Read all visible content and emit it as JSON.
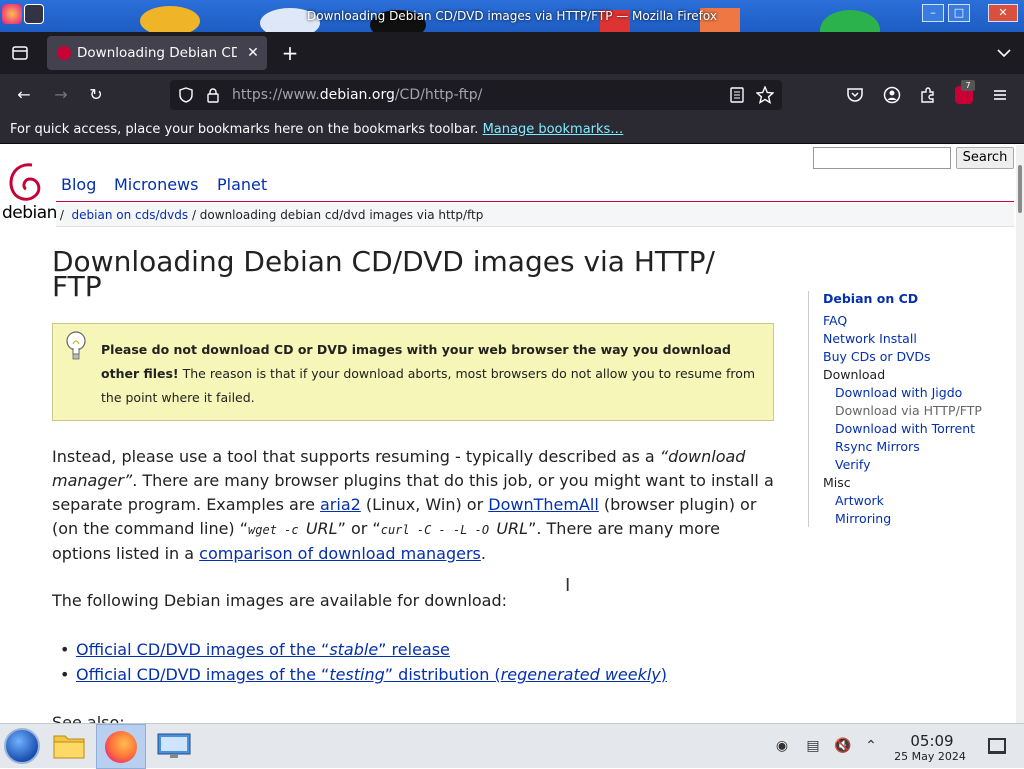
{
  "window": {
    "title": "Downloading Debian CD/DVD images via HTTP/FTP — Mozilla Firefox",
    "minimize_label": "–",
    "maximize_label": "□",
    "close_label": "✕"
  },
  "tabs": [
    {
      "title": "Downloading Debian CD/DVD images via HTTP/FTP",
      "active": true,
      "close_label": "✕"
    }
  ],
  "new_tab_label": "+",
  "tab_list_label": "⌄",
  "nav": {
    "back_label": "←",
    "forward_label": "→",
    "reload_label": "↻",
    "url_prefix": "https://www.",
    "url_host": "debian.org",
    "url_path": "/CD/http-ftp/",
    "extension_badge": "7"
  },
  "bookmarks_bar": {
    "text": "For quick access, place your bookmarks here on the bookmarks toolbar.",
    "link": "Manage bookmarks…"
  },
  "site": {
    "logo_text": "debian",
    "topnav": [
      "Blog",
      "Micronews",
      "Planet"
    ],
    "search_placeholder": "",
    "search_button": "Search",
    "breadcrumb": {
      "sep": "/",
      "link": "debian on cds/dvds",
      "current": "/ downloading debian cd/dvd images via http/ftp"
    },
    "heading_line1": "Downloading Debian CD/DVD images via HTTP/",
    "heading_line2": "FTP",
    "warning": {
      "bold": "Please do not download CD or DVD images with your web browser the way you download other files!",
      "rest": " The reason is that if your download aborts, most browsers do not allow you to resume from the point where it failed."
    },
    "para1": {
      "t1": "Instead, please use a tool that supports resuming - typically described as a ",
      "em1": "“download manager”",
      "t2": ". There are many browser plugins that do this job, or you might want to install a separate program. Examples are ",
      "link1": "aria2",
      "t3": " (Linux, Win) or ",
      "link2": "DownThemAll",
      "t4": " (browser plugin) or (on the command line) “",
      "code1": "wget -c ",
      "em2": "URL",
      "t5": "” or “",
      "code2": "curl -C - -L -O ",
      "em3": "URL",
      "t6": "”. There are many more options listed in a ",
      "link3": "comparison of download managers",
      "t7": "."
    },
    "para2": "The following Debian images are available for download:",
    "list": [
      {
        "pre": "Official CD/DVD images of the “",
        "em": "stable",
        "post": "” release",
        "extra_em": "",
        "extra_post": ""
      },
      {
        "pre": "Official CD/DVD images of the “",
        "em": "testing",
        "post": "” distribution (",
        "extra_em": "regenerated weekly",
        "extra_post": ")"
      }
    ],
    "see_also": "See also:",
    "sidebar": {
      "title": "Debian on CD",
      "items": [
        {
          "label": "FAQ",
          "type": "link"
        },
        {
          "label": "Network Install",
          "type": "link"
        },
        {
          "label": "Buy CDs or DVDs",
          "type": "link"
        },
        {
          "label": "Download",
          "type": "static"
        },
        {
          "label": "Download with Jigdo",
          "type": "link-sub"
        },
        {
          "label": "Download via HTTP/FTP",
          "type": "current-sub"
        },
        {
          "label": "Download with Torrent",
          "type": "link-sub"
        },
        {
          "label": "Rsync Mirrors",
          "type": "link-sub"
        },
        {
          "label": "Verify",
          "type": "link-sub"
        },
        {
          "label": "Misc",
          "type": "static"
        },
        {
          "label": "Artwork",
          "type": "link-sub"
        },
        {
          "label": "Mirroring",
          "type": "link-sub"
        }
      ]
    }
  },
  "taskbar": {
    "time": "05:09",
    "date": "25 May 2024"
  },
  "colors": {
    "debian_red": "#c70036",
    "link_blue": "#0530ad",
    "warning_bg": "#f5f6b7",
    "firefox_chrome": "#2b2a33"
  }
}
